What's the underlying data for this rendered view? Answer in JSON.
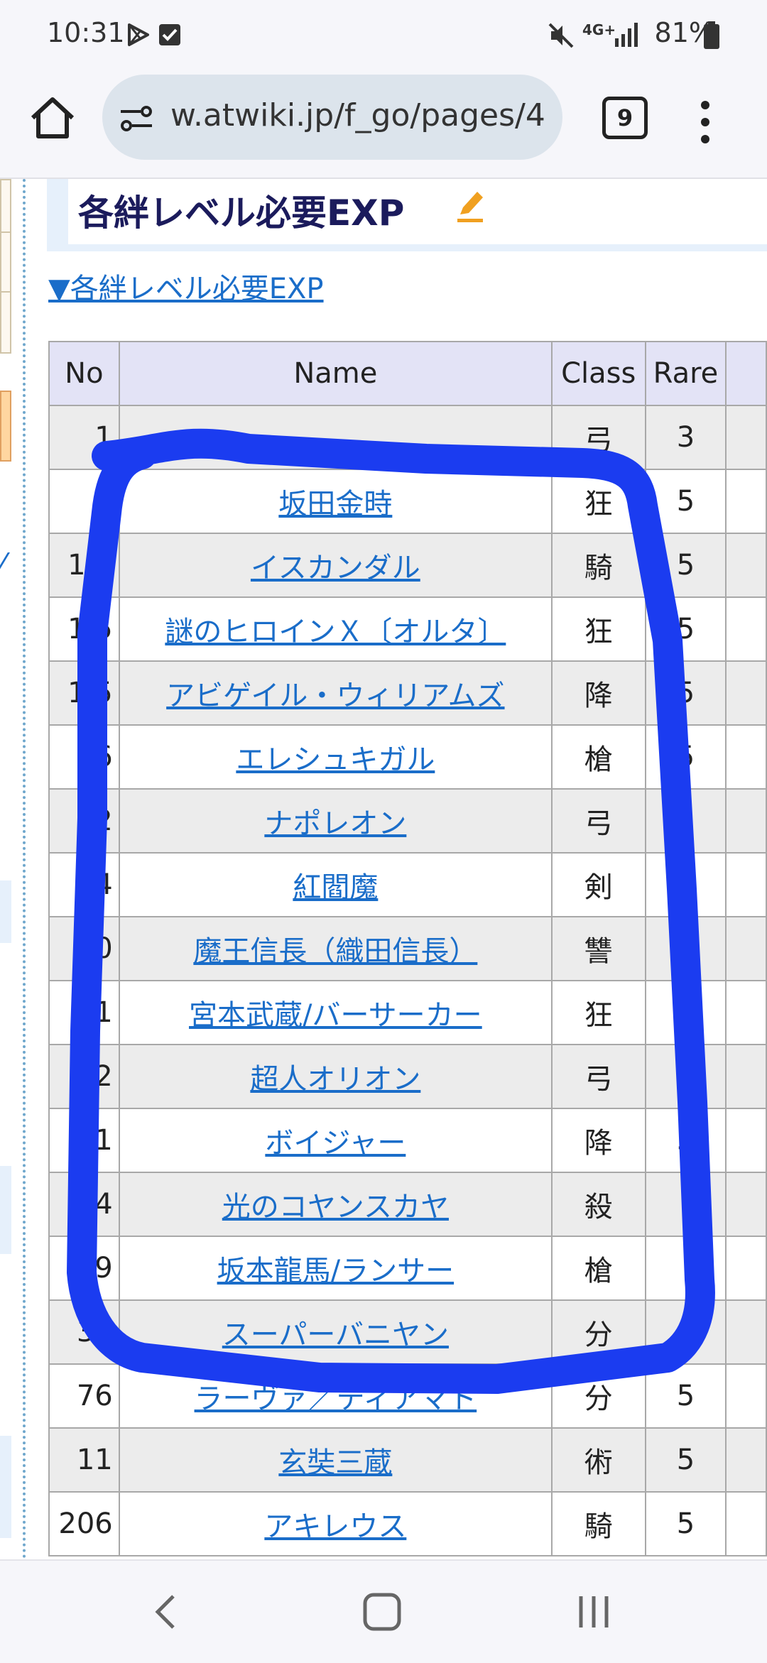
{
  "status_bar": {
    "time": "10:31",
    "battery": "81%",
    "network": "4G+",
    "icons": [
      "play-store-icon",
      "checkbox-icon",
      "mute-icon",
      "network-icon",
      "signal-icon",
      "battery-icon"
    ]
  },
  "browser": {
    "url": "w.atwiki.jp/f_go/pages/4",
    "tab_count": "9"
  },
  "page": {
    "heading": "各絆レベル必要EXP",
    "anchor_link": "▼各絆レベル必要EXP",
    "table": {
      "headers": [
        "No",
        "Name",
        "Class",
        "Rare"
      ],
      "rows": [
        {
          "no": "1",
          "name": "",
          "class": "弓",
          "rare": "3"
        },
        {
          "no": "",
          "name": "坂田金時",
          "class": "狂",
          "rare": "5"
        },
        {
          "no": "1 8",
          "name": "イスカンダル",
          "class": "騎",
          "rare": "5"
        },
        {
          "no": "1 5",
          "name": "謎のヒロインＸ〔オルタ〕",
          "class": "狂",
          "rare": "5"
        },
        {
          "no": "1 5",
          "name": "アビゲイル・ウィリアムズ",
          "class": "降",
          "rare": "5"
        },
        {
          "no": "6",
          "name": "エレシュキガル",
          "class": "槍",
          "rare": "5"
        },
        {
          "no": "2",
          "name": "ナポレオン",
          "class": "弓",
          "rare": "5"
        },
        {
          "no": "34",
          "name": "紅閻魔",
          "class": "剣",
          "rare": "5"
        },
        {
          "no": "50",
          "name": "魔王信長（織田信長）",
          "class": "讐",
          "rare": "5"
        },
        {
          "no": "61",
          "name": "宮本武蔵/バーサーカー",
          "class": "狂",
          "rare": "5"
        },
        {
          "no": "72",
          "name": "超人オリオン",
          "class": "弓",
          "rare": "5"
        },
        {
          "no": "31",
          "name": "ボイジャー",
          "class": "降",
          "rare": "5"
        },
        {
          "no": "14",
          "name": "光のコヤンスカヤ",
          "class": "殺",
          "rare": ""
        },
        {
          "no": "29",
          "name": "坂本龍馬/ランサー",
          "class": "槍",
          "rare": ""
        },
        {
          "no": "39",
          "name": "スーパーバニヤン",
          "class": "分",
          "rare": ""
        },
        {
          "no": "76",
          "name": "ラーヴァ／ティアマト",
          "class": "分",
          "rare": "5"
        },
        {
          "no": "11",
          "name": "玄奘三蔵",
          "class": "術",
          "rare": "5"
        },
        {
          "no": "206",
          "name": "アキレウス",
          "class": "騎",
          "rare": "5"
        }
      ]
    }
  },
  "annotation": {
    "color": "#1b3cf0"
  },
  "colors": {
    "link": "#1a6dc9",
    "header_bg": "#e3e3f6",
    "row_alt_bg": "#ececec"
  }
}
